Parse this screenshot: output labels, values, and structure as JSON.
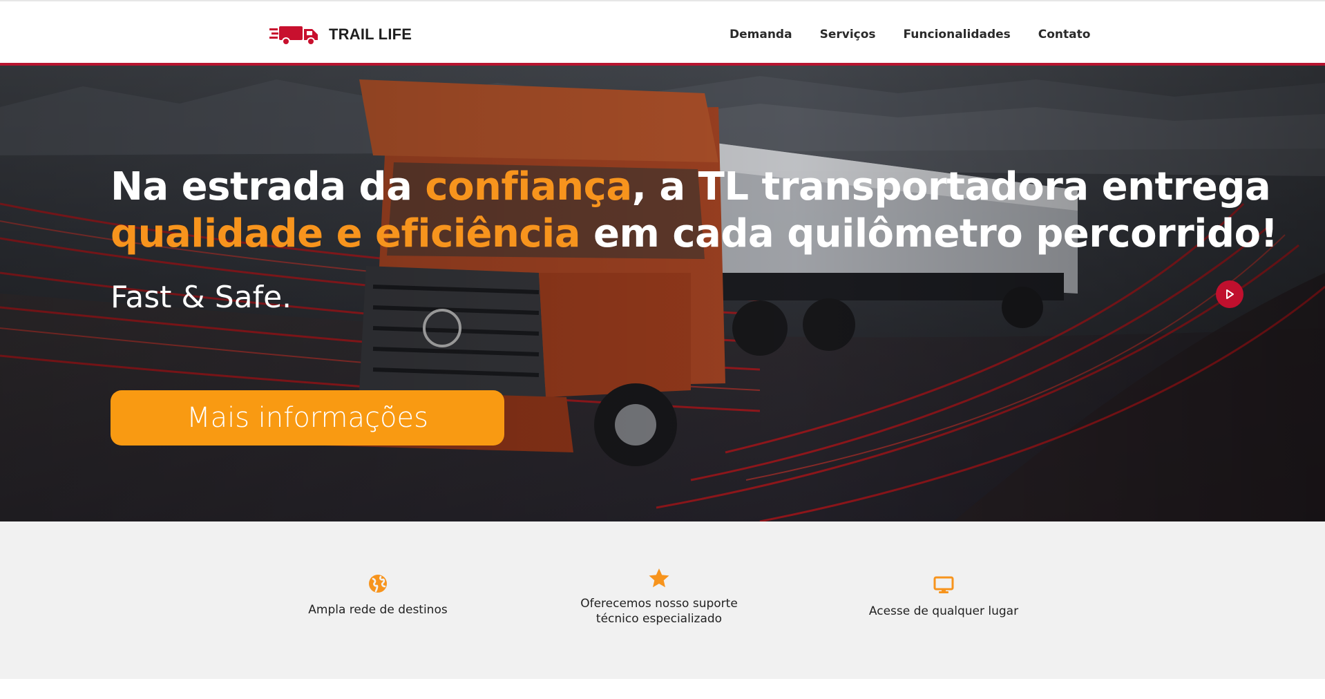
{
  "header": {
    "logo_text": "TRAIL LIFE",
    "logo_icon": "truck-speed-icon",
    "nav": [
      {
        "label": "Demanda"
      },
      {
        "label": "Serviços"
      },
      {
        "label": "Funcionalidades"
      },
      {
        "label": "Contato"
      }
    ]
  },
  "hero": {
    "title_part1": "Na estrada da ",
    "title_highlight1": "confiança",
    "title_part2": ", a TL transportadora entrega ",
    "title_highlight2": "qualidade e eficiência",
    "title_part3": " em cada quilômetro percorrido!",
    "subtitle": "Fast & Safe.",
    "button_label": "Mais informações",
    "next_icon": "play-icon"
  },
  "features": [
    {
      "icon": "globe-icon",
      "label": "Ampla rede de destinos"
    },
    {
      "icon": "star-icon",
      "label_line1": "Oferecemos nosso suporte",
      "label_line2": "técnico especializado"
    },
    {
      "icon": "monitor-icon",
      "label": "Acesse de qualquer lugar"
    }
  ],
  "colors": {
    "brand_red": "#b7142f",
    "accent_orange": "#f7941d",
    "button_orange": "#f99a12",
    "features_bg": "#f1f1f1"
  }
}
